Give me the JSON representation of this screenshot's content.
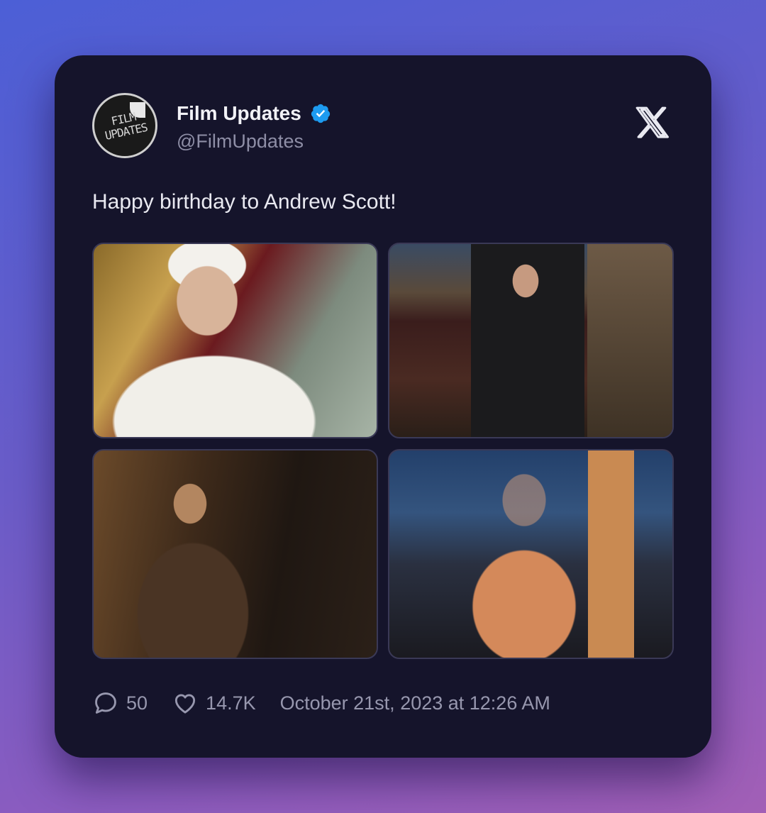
{
  "account": {
    "avatar_text_line1": "FILM",
    "avatar_text_line2": "UPDATES",
    "name": "Film Updates",
    "handle": "@FilmUpdates",
    "verified": true
  },
  "platform_icon": "x-logo-icon",
  "tweet": {
    "text": "Happy birthday to Andrew Scott!"
  },
  "photos": [
    {
      "name": "photo-1-king-in-ermine-robe"
    },
    {
      "name": "photo-2-priest-in-church"
    },
    {
      "name": "photo-3-man-with-cigarette-by-brick-wall"
    },
    {
      "name": "photo-4-man-at-window-night-city"
    }
  ],
  "stats": {
    "replies": "50",
    "likes": "14.7K",
    "timestamp": "October 21st, 2023 at 12:26 AM"
  },
  "colors": {
    "card_bg": "#15142b",
    "verified_badge": "#1d9bf0",
    "muted_text": "#9797ae"
  }
}
